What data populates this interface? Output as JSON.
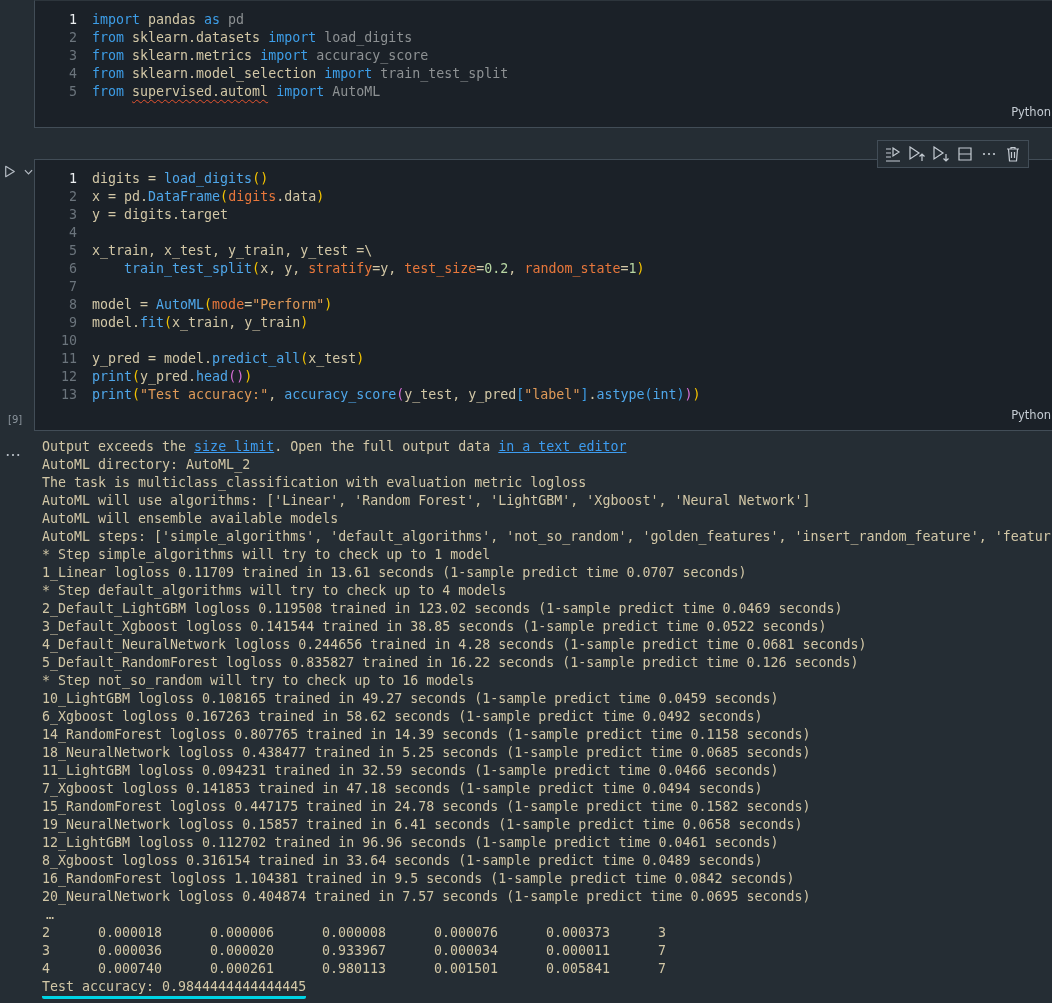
{
  "cells": [
    {
      "language": "Python",
      "lines": [
        {
          "number": "1",
          "active": true,
          "tokens": [
            {
              "text": "import",
              "kind": "kw"
            },
            {
              "text": " pandas ",
              "kind": "mod"
            },
            {
              "text": "as",
              "kind": "kw"
            },
            {
              "text": " pd",
              "kind": "dim"
            }
          ]
        },
        {
          "number": "2",
          "active": false,
          "tokens": [
            {
              "text": "from",
              "kind": "kw"
            },
            {
              "text": " sklearn.datasets ",
              "kind": "mod"
            },
            {
              "text": "import",
              "kind": "kw"
            },
            {
              "text": " load_digits",
              "kind": "dim"
            }
          ]
        },
        {
          "number": "3",
          "active": false,
          "tokens": [
            {
              "text": "from",
              "kind": "kw"
            },
            {
              "text": " sklearn.metrics ",
              "kind": "mod"
            },
            {
              "text": "import",
              "kind": "kw"
            },
            {
              "text": " accuracy_score",
              "kind": "dim"
            }
          ]
        },
        {
          "number": "4",
          "active": false,
          "tokens": [
            {
              "text": "from",
              "kind": "kw"
            },
            {
              "text": " sklearn.model_selection ",
              "kind": "mod"
            },
            {
              "text": "import",
              "kind": "kw"
            },
            {
              "text": " train_test_split",
              "kind": "dim"
            }
          ]
        },
        {
          "number": "5",
          "active": false,
          "tokens": [
            {
              "text": "from ",
              "kind": "kw"
            },
            {
              "text": "supervised.automl",
              "kind": "mod",
              "squiggle": true
            },
            {
              "text": " import",
              "kind": "kw"
            },
            {
              "text": " AutoML",
              "kind": "dim"
            }
          ]
        }
      ]
    },
    {
      "run_button": true,
      "toolbar": true,
      "execution_count": "[9]",
      "language": "Python",
      "lines": [
        {
          "number": "1",
          "active": true,
          "tokens": [
            {
              "text": "digits = ",
              "kind": "name"
            },
            {
              "text": "load_digits",
              "kind": "func"
            },
            {
              "text": "()",
              "kind": "paren"
            }
          ]
        },
        {
          "number": "2",
          "active": false,
          "tokens": [
            {
              "text": "x = pd.",
              "kind": "name"
            },
            {
              "text": "DataFrame",
              "kind": "func"
            },
            {
              "text": "(",
              "kind": "paren"
            },
            {
              "text": "digits",
              "kind": "param"
            },
            {
              "text": ".data",
              "kind": "name"
            },
            {
              "text": ")",
              "kind": "paren"
            }
          ]
        },
        {
          "number": "3",
          "active": false,
          "tokens": [
            {
              "text": "y = digits.target",
              "kind": "name"
            }
          ]
        },
        {
          "number": "4",
          "active": false
        },
        {
          "number": "5",
          "active": false,
          "tokens": [
            {
              "text": "x_train, x_test, y_train, y_test =\\",
              "kind": "name"
            }
          ]
        },
        {
          "number": "6",
          "active": false,
          "tokens": [
            {
              "text": "    train_test_split",
              "kind": "func"
            },
            {
              "text": "(",
              "kind": "paren"
            },
            {
              "text": "x, y, ",
              "kind": "name"
            },
            {
              "text": "stratify",
              "kind": "param"
            },
            {
              "text": "=y, ",
              "kind": "name"
            },
            {
              "text": "test_size",
              "kind": "param"
            },
            {
              "text": "=",
              "kind": "name"
            },
            {
              "text": "0.2",
              "kind": "num"
            },
            {
              "text": ", ",
              "kind": "name"
            },
            {
              "text": "random_state",
              "kind": "param"
            },
            {
              "text": "=",
              "kind": "name"
            },
            {
              "text": "1",
              "kind": "num"
            },
            {
              "text": ")",
              "kind": "paren"
            }
          ]
        },
        {
          "number": "7",
          "active": false
        },
        {
          "number": "8",
          "active": false,
          "tokens": [
            {
              "text": "model = ",
              "kind": "name"
            },
            {
              "text": "AutoML",
              "kind": "func"
            },
            {
              "text": "(",
              "kind": "paren"
            },
            {
              "text": "mode",
              "kind": "param"
            },
            {
              "text": "=",
              "kind": "name"
            },
            {
              "text": "\"Perform\"",
              "kind": "str"
            },
            {
              "text": ")",
              "kind": "paren"
            }
          ]
        },
        {
          "number": "9",
          "active": false,
          "tokens": [
            {
              "text": "model.",
              "kind": "name"
            },
            {
              "text": "fit",
              "kind": "func"
            },
            {
              "text": "(",
              "kind": "paren"
            },
            {
              "text": "x_train, y_train",
              "kind": "name"
            },
            {
              "text": ")",
              "kind": "paren"
            }
          ]
        },
        {
          "number": "10",
          "active": false
        },
        {
          "number": "11",
          "active": false,
          "tokens": [
            {
              "text": "y_pred = model.",
              "kind": "name"
            },
            {
              "text": "predict_all",
              "kind": "func"
            },
            {
              "text": "(",
              "kind": "paren"
            },
            {
              "text": "x_test",
              "kind": "name"
            },
            {
              "text": ")",
              "kind": "paren"
            }
          ]
        },
        {
          "number": "12",
          "active": false,
          "tokens": [
            {
              "text": "print",
              "kind": "func"
            },
            {
              "text": "(",
              "kind": "paren"
            },
            {
              "text": "y_pred.",
              "kind": "name"
            },
            {
              "text": "head",
              "kind": "func"
            },
            {
              "text": "()",
              "kind": "paren2"
            },
            {
              "text": ")",
              "kind": "paren"
            }
          ]
        },
        {
          "number": "13",
          "active": false,
          "tokens": [
            {
              "text": "print",
              "kind": "func"
            },
            {
              "text": "(",
              "kind": "paren"
            },
            {
              "text": "\"Test accuracy:\"",
              "kind": "str"
            },
            {
              "text": ", ",
              "kind": "name"
            },
            {
              "text": "accuracy_score",
              "kind": "func"
            },
            {
              "text": "(",
              "kind": "paren2"
            },
            {
              "text": "y_test, y_pred",
              "kind": "name"
            },
            {
              "text": "[",
              "kind": "paren3"
            },
            {
              "text": "\"label\"",
              "kind": "str"
            },
            {
              "text": "]",
              "kind": "paren3"
            },
            {
              "text": ".",
              "kind": "name"
            },
            {
              "text": "astype",
              "kind": "func"
            },
            {
              "text": "(",
              "kind": "paren3"
            },
            {
              "text": "int",
              "kind": "func"
            },
            {
              "text": ")",
              "kind": "paren3"
            },
            {
              "text": ")",
              "kind": "paren2"
            },
            {
              "text": ")",
              "kind": "paren"
            }
          ]
        }
      ]
    }
  ],
  "output": {
    "notice": [
      {
        "text": "Output exceeds the ",
        "link": false
      },
      {
        "text": "size limit",
        "link": true
      },
      {
        "text": ". Open the full output data ",
        "link": false
      },
      {
        "text": "in a text editor",
        "link": true
      }
    ],
    "lines": [
      "AutoML directory: AutoML_2",
      "The task is multiclass_classification with evaluation metric logloss",
      "AutoML will use algorithms: ['Linear', 'Random Forest', 'LightGBM', 'Xgboost', 'Neural Network']",
      "AutoML will ensemble available models",
      "AutoML steps: ['simple_algorithms', 'default_algorithms', 'not_so_random', 'golden_features', 'insert_random_feature', 'featur",
      "* Step simple_algorithms will try to check up to 1 model",
      "1_Linear logloss 0.11709 trained in 13.61 seconds (1-sample predict time 0.0707 seconds)",
      "* Step default_algorithms will try to check up to 4 models",
      "2_Default_LightGBM logloss 0.119508 trained in 123.02 seconds (1-sample predict time 0.0469 seconds)",
      "3_Default_Xgboost logloss 0.141544 trained in 38.85 seconds (1-sample predict time 0.0522 seconds)",
      "4_Default_NeuralNetwork logloss 0.244656 trained in 4.28 seconds (1-sample predict time 0.0681 seconds)",
      "5_Default_RandomForest logloss 0.835827 trained in 16.22 seconds (1-sample predict time 0.126 seconds)",
      "* Step not_so_random will try to check up to 16 models",
      "10_LightGBM logloss 0.108165 trained in 49.27 seconds (1-sample predict time 0.0459 seconds)",
      "6_Xgboost logloss 0.167263 trained in 58.62 seconds (1-sample predict time 0.0492 seconds)",
      "14_RandomForest logloss 0.807765 trained in 14.39 seconds (1-sample predict time 0.1158 seconds)",
      "18_NeuralNetwork logloss 0.438477 trained in 5.25 seconds (1-sample predict time 0.0685 seconds)",
      "11_LightGBM logloss 0.094231 trained in 32.59 seconds (1-sample predict time 0.0466 seconds)",
      "7_Xgboost logloss 0.141853 trained in 47.18 seconds (1-sample predict time 0.0494 seconds)",
      "15_RandomForest logloss 0.447175 trained in 24.78 seconds (1-sample predict time 0.1582 seconds)",
      "19_NeuralNetwork logloss 0.15857 trained in 6.41 seconds (1-sample predict time 0.0658 seconds)",
      "12_LightGBM logloss 0.112702 trained in 96.96 seconds (1-sample predict time 0.0461 seconds)",
      "8_Xgboost logloss 0.316154 trained in 33.64 seconds (1-sample predict time 0.0489 seconds)",
      "16_RandomForest logloss 1.104381 trained in 9.5 seconds (1-sample predict time 0.0842 seconds)",
      "20_NeuralNetwork logloss 0.404874 trained in 7.57 seconds (1-sample predict time 0.0695 seconds)"
    ],
    "truncation": "…",
    "table_rows": [
      [
        "2",
        "0.000018",
        "0.000006",
        "0.000008",
        "0.000076",
        "0.000373",
        "3"
      ],
      [
        "3",
        "0.000036",
        "0.000020",
        "0.933967",
        "0.000034",
        "0.000011",
        "7"
      ],
      [
        "4",
        "0.000740",
        "0.000261",
        "0.980113",
        "0.001501",
        "0.005841",
        "7"
      ]
    ],
    "result": {
      "text": "Test accuracy: 0.9844444444444445",
      "underlined": true
    }
  }
}
